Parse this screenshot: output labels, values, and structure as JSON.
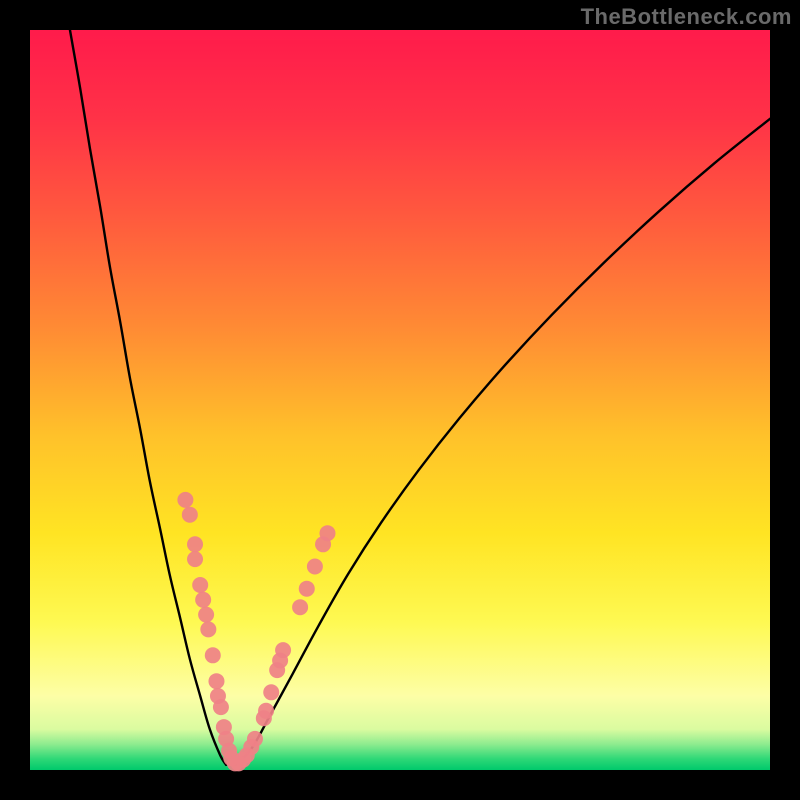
{
  "watermark": "TheBottleneck.com",
  "gradient": {
    "stops": [
      {
        "offset": 0.0,
        "color": "#ff1b4b"
      },
      {
        "offset": 0.12,
        "color": "#ff3247"
      },
      {
        "offset": 0.25,
        "color": "#ff593e"
      },
      {
        "offset": 0.4,
        "color": "#ff8a34"
      },
      {
        "offset": 0.55,
        "color": "#ffc22a"
      },
      {
        "offset": 0.68,
        "color": "#ffe423"
      },
      {
        "offset": 0.8,
        "color": "#fef952"
      },
      {
        "offset": 0.9,
        "color": "#fdfea6"
      },
      {
        "offset": 0.945,
        "color": "#dafba0"
      },
      {
        "offset": 0.965,
        "color": "#8eec8f"
      },
      {
        "offset": 0.985,
        "color": "#2ed877"
      },
      {
        "offset": 1.0,
        "color": "#00c96c"
      }
    ]
  },
  "chart_data": {
    "type": "line",
    "title": "",
    "xlabel": "",
    "ylabel": "",
    "xlim": [
      0,
      100
    ],
    "ylim": [
      0,
      100
    ],
    "series": [
      {
        "name": "left-branch",
        "x": [
          5.4,
          6.8,
          8.1,
          9.5,
          10.8,
          12.2,
          13.5,
          14.9,
          16.2,
          17.6,
          18.9,
          20.3,
          21.6,
          23.0,
          24.3,
          25.7,
          26.5
        ],
        "y": [
          100.0,
          92.0,
          84.0,
          76.0,
          68.0,
          60.5,
          53.0,
          46.0,
          39.0,
          32.5,
          26.3,
          20.5,
          15.0,
          10.0,
          5.5,
          2.0,
          0.7
        ]
      },
      {
        "name": "right-branch",
        "x": [
          27.8,
          30.0,
          32.5,
          35.5,
          39.0,
          43.0,
          47.5,
          52.5,
          58.0,
          64.0,
          70.5,
          77.5,
          85.0,
          92.5,
          100.0
        ],
        "y": [
          0.7,
          3.0,
          7.5,
          13.0,
          19.5,
          26.5,
          33.5,
          40.5,
          47.5,
          54.5,
          61.5,
          68.5,
          75.5,
          82.0,
          88.0
        ]
      }
    ],
    "annotations": {
      "name": "pink-dot-clusters",
      "color": "#ef8187",
      "radius_px": 8,
      "points_xy": [
        [
          21.0,
          36.5
        ],
        [
          21.6,
          34.5
        ],
        [
          22.3,
          30.5
        ],
        [
          22.3,
          28.5
        ],
        [
          23.0,
          25.0
        ],
        [
          23.4,
          23.0
        ],
        [
          23.8,
          21.0
        ],
        [
          24.1,
          19.0
        ],
        [
          24.7,
          15.5
        ],
        [
          25.2,
          12.0
        ],
        [
          25.4,
          10.0
        ],
        [
          25.8,
          8.5
        ],
        [
          26.2,
          5.8
        ],
        [
          26.5,
          4.2
        ],
        [
          26.9,
          2.6
        ],
        [
          27.2,
          1.6
        ],
        [
          27.7,
          0.9
        ],
        [
          28.2,
          0.9
        ],
        [
          28.8,
          1.4
        ],
        [
          29.3,
          2.0
        ],
        [
          29.9,
          3.1
        ],
        [
          30.4,
          4.2
        ],
        [
          31.6,
          7.0
        ],
        [
          31.9,
          8.0
        ],
        [
          32.6,
          10.5
        ],
        [
          33.4,
          13.5
        ],
        [
          33.8,
          14.8
        ],
        [
          34.2,
          16.2
        ],
        [
          36.5,
          22.0
        ],
        [
          37.4,
          24.5
        ],
        [
          38.5,
          27.5
        ],
        [
          39.6,
          30.5
        ],
        [
          40.2,
          32.0
        ]
      ]
    }
  }
}
